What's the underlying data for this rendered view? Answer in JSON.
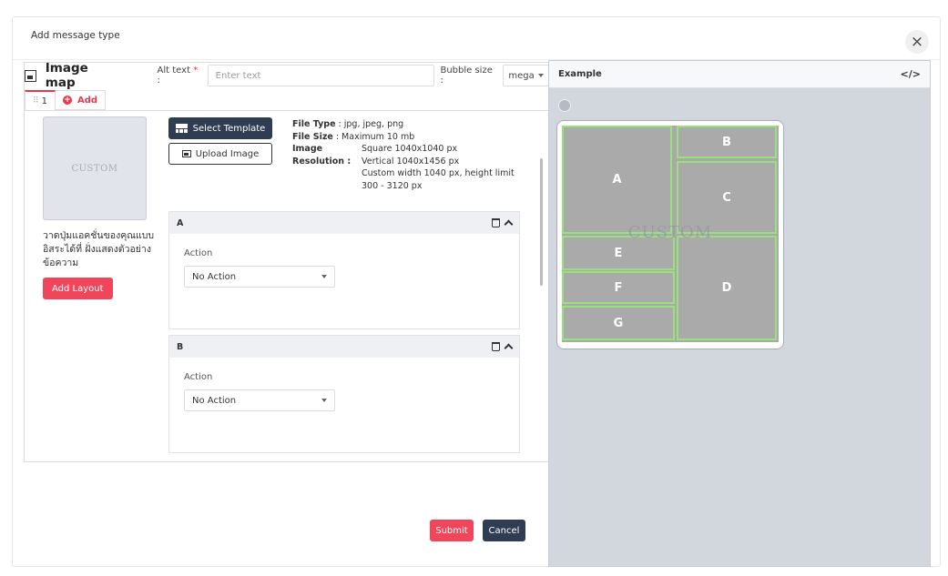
{
  "modal": {
    "title": "Add message type",
    "close_symbol": "×"
  },
  "editor": {
    "title": "Image map",
    "alt_text_label": "Alt text",
    "alt_text_required": "*",
    "alt_text_colon": " :",
    "alt_text_placeholder": "Enter text",
    "alt_text_value": "",
    "bubble_size_label": "Bubble size :",
    "bubble_size_value": "mega",
    "tabs": [
      {
        "label": "1"
      }
    ],
    "add_tab_label": "Add"
  },
  "layout_preview": {
    "watermark": "CUSTOM",
    "description": "วาดปุ่มแอคชั่นของคุณแบบอิสระได้ที่ ฝั่งแสดงตัวอย่างข้อความ",
    "add_layout_label": "Add Layout"
  },
  "buttons": {
    "select_template": "Select Template",
    "upload_image": "Upload Image",
    "submit": "Submit",
    "cancel": "Cancel"
  },
  "file_info": {
    "file_type_key": "File Type",
    "file_type_value": ": jpg, jpeg, png",
    "file_size_key": "File Size",
    "file_size_value": ": Maximum 10 mb",
    "image_key": "Image",
    "resolution_key": "Resolution :",
    "res_square": "Square 1040x1040 px",
    "res_vertical": "Vertical 1040x1456 px",
    "res_custom": "Custom width 1040 px, height limit",
    "res_custom_range": "300 - 3120 px"
  },
  "sections": [
    {
      "name": "A",
      "action_label": "Action",
      "action_value": "No Action"
    },
    {
      "name": "B",
      "action_label": "Action",
      "action_value": "No Action"
    }
  ],
  "example": {
    "title": "Example",
    "code_symbol": "</>",
    "card_watermark": "CUSTOM",
    "areas": [
      "A",
      "B",
      "C",
      "D",
      "E",
      "F",
      "G"
    ],
    "area_border_color": "#9be07f"
  }
}
